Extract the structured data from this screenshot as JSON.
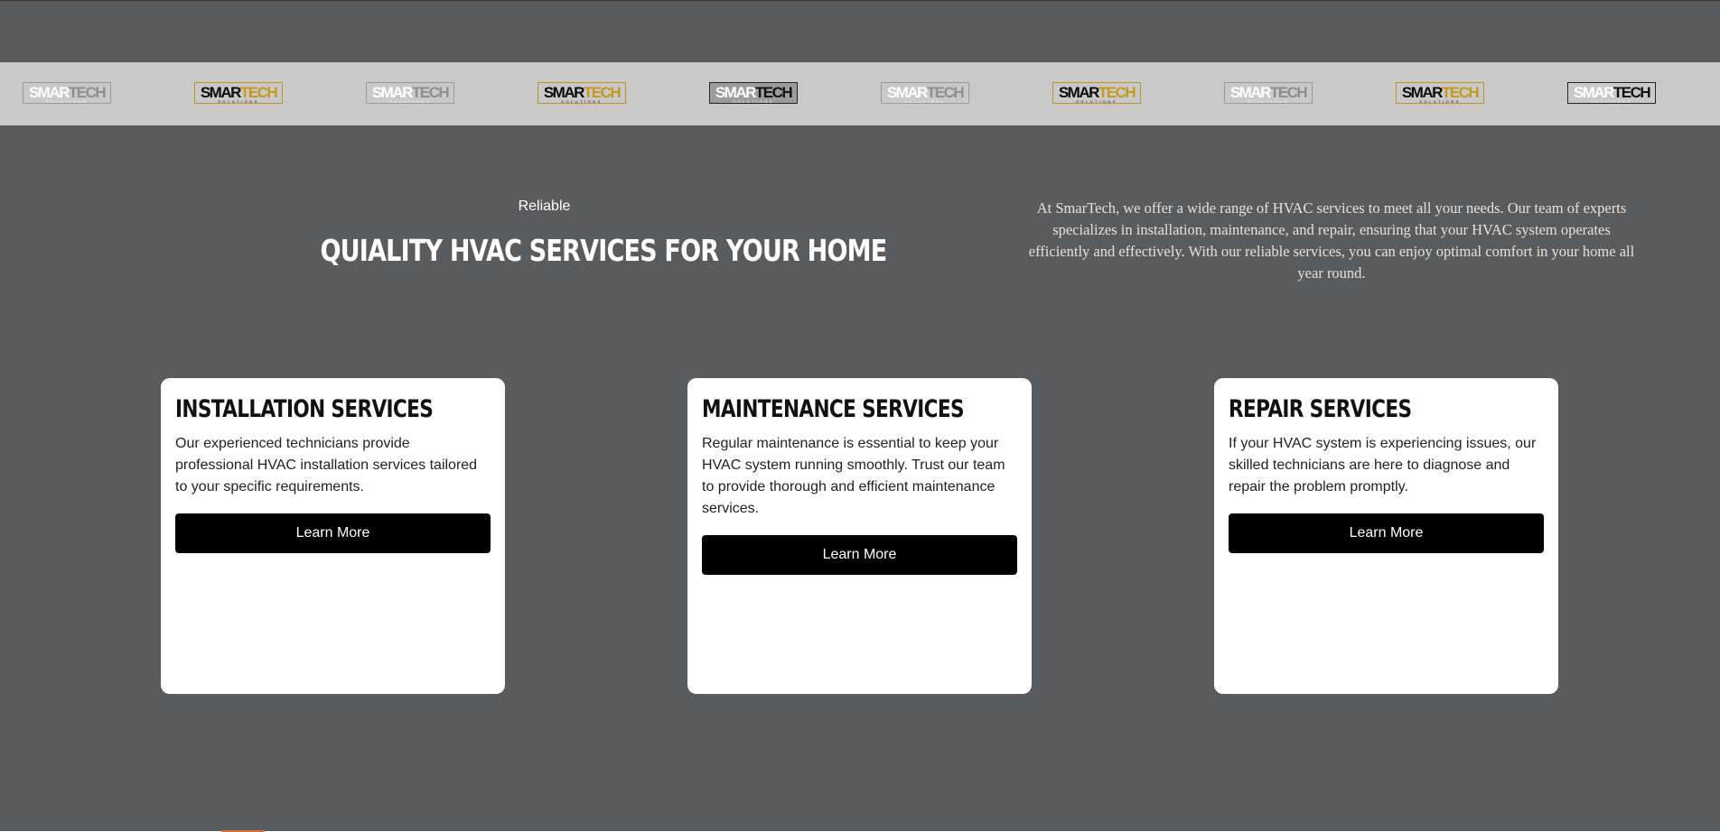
{
  "logo_strip": {
    "logos": [
      {
        "part_a": "SMAR",
        "part_b": "TECH",
        "sub": "SOLUTIONS",
        "style": "light"
      },
      {
        "part_a": "SMAR",
        "part_b": "TECH",
        "sub": "SOLUTIONS",
        "style": "gold"
      },
      {
        "part_a": "SMAR",
        "part_b": "TECH",
        "sub": "SOLUTIONS",
        "style": "light"
      },
      {
        "part_a": "SMAR",
        "part_b": "TECH",
        "sub": "SOLUTIONS",
        "style": "gold"
      },
      {
        "part_a": "SMAR",
        "part_b": "TECH",
        "sub": "SOLUTIONS",
        "style": "dark"
      },
      {
        "part_a": "SMAR",
        "part_b": "TECH",
        "sub": "SOLUTIONS",
        "style": "light"
      },
      {
        "part_a": "SMAR",
        "part_b": "TECH",
        "sub": "SOLUTIONS",
        "style": "gold"
      },
      {
        "part_a": "SMAR",
        "part_b": "TECH",
        "sub": "SOLUTIONS",
        "style": "light"
      },
      {
        "part_a": "SMAR",
        "part_b": "TECH",
        "sub": "SOLUTIONS",
        "style": "gold"
      },
      {
        "part_a": "SMAR",
        "part_b": "TECH",
        "sub": "SOLUTIONS",
        "style": "lightdark"
      }
    ]
  },
  "hero": {
    "eyebrow": "Reliable",
    "headline": "QUIALITY HVAC SERVICES FOR YOUR HOME",
    "intro": "At SmarTech, we offer a wide range of HVAC services to meet all your needs. Our team of experts specializes in installation, maintenance, and repair, ensuring that your HVAC system operates efficiently and effectively. With our reliable services, you can enjoy optimal comfort in your home all year round."
  },
  "cards": [
    {
      "title": "INSTALLATION SERVICES",
      "body": "Our experienced technicians provide professional HVAC installation services tailored to your specific requirements.",
      "button": "Learn More"
    },
    {
      "title": "MAINTENANCE SERVICES",
      "body": "Regular maintenance is essential to keep your HVAC system running smoothly. Trust our team to provide thorough and efficient maintenance services.",
      "button": "Learn More"
    },
    {
      "title": "REPAIR SERVICES",
      "body": "If your HVAC system is experiencing issues, our skilled technicians are here to diagnose and repair the problem promptly.",
      "button": "Learn More"
    }
  ],
  "colors": {
    "background": "#5a5b5d",
    "logo_strip": "#c9c9c9",
    "card": "#ffffff",
    "button": "#000000",
    "gold_accent": "#c49a1c"
  }
}
